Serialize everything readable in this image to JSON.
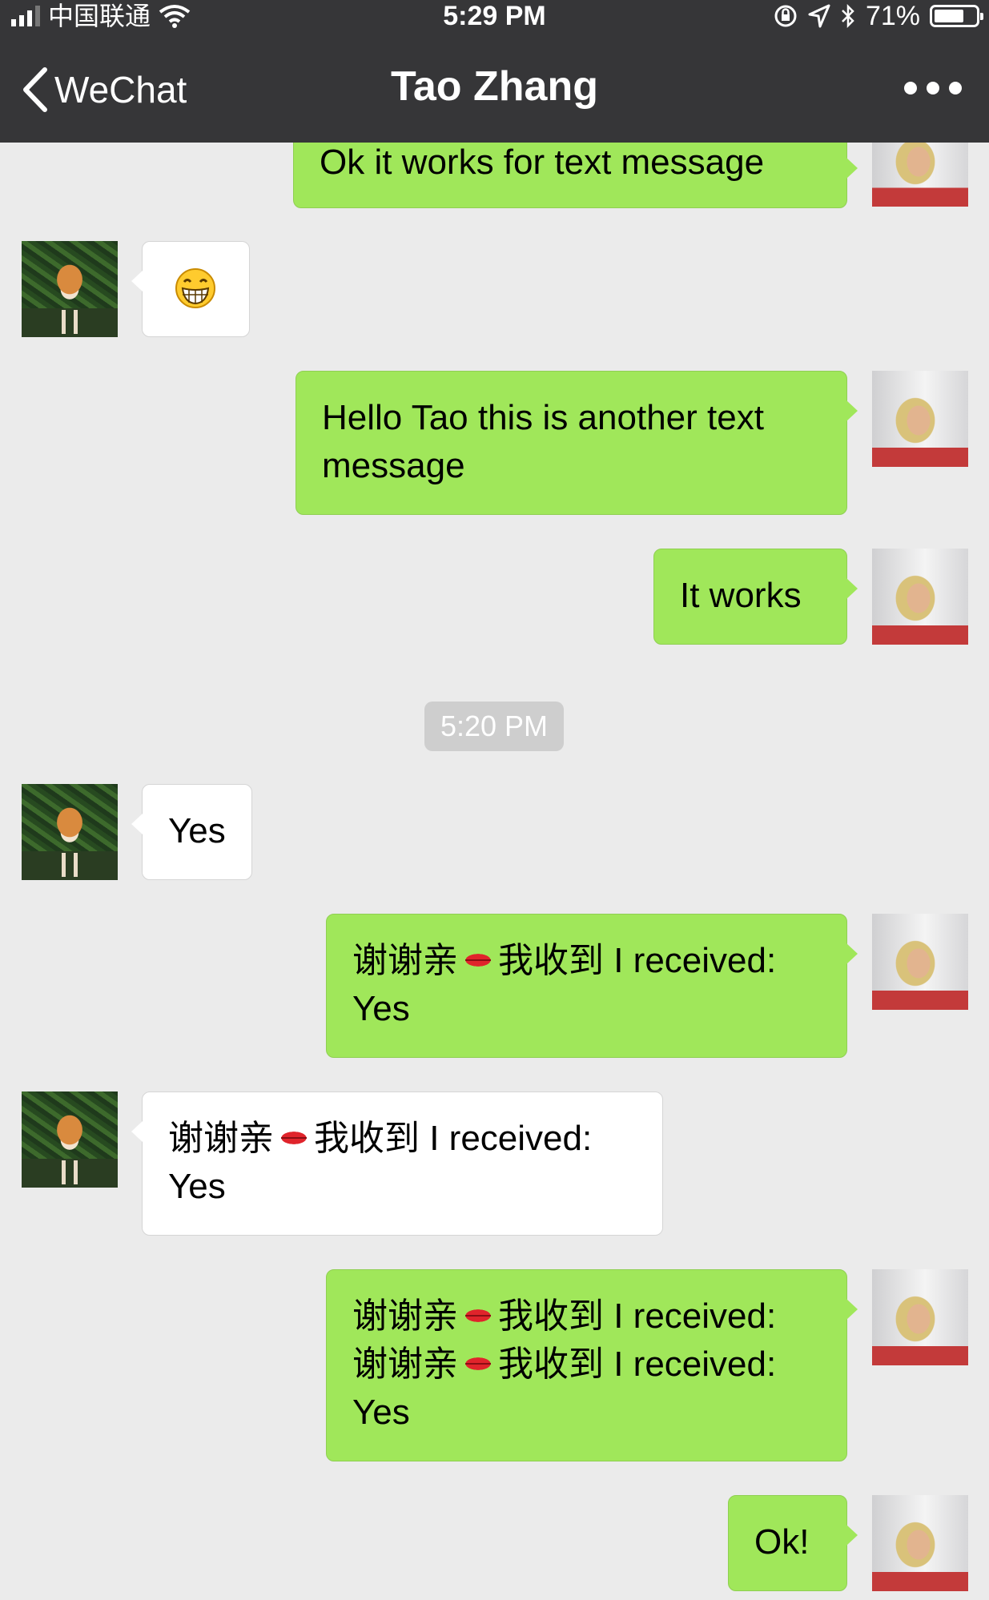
{
  "status_bar": {
    "carrier": "中国联通",
    "time": "5:29 PM",
    "battery": "71%",
    "battery_level": 0.71
  },
  "nav": {
    "back_label": "WeChat",
    "title": "Tao Zhang",
    "more_icon": "more-icon"
  },
  "messages": [
    {
      "from": "me",
      "text": "Ok it works for text message"
    },
    {
      "from": "them",
      "emoji": "grinning-face-icon"
    },
    {
      "from": "me",
      "text_line1": "Hello Tao this is another text",
      "text_line2": "message"
    },
    {
      "from": "me",
      "text": "It works"
    },
    {
      "from": "them",
      "text": "Yes"
    },
    {
      "from": "me",
      "a": "谢谢亲",
      "b": "我收到 I received:",
      "c": "Yes"
    },
    {
      "from": "them",
      "a": "谢谢亲",
      "b": "我收到 I received:",
      "c": "Yes"
    },
    {
      "from": "me",
      "a": "谢谢亲",
      "b": "我收到 I received:",
      "d": "谢谢亲",
      "e": "我收到 I received:",
      "c": "Yes"
    },
    {
      "from": "me",
      "text": "Ok!"
    }
  ],
  "timestamp": "5:20 PM",
  "colors": {
    "header": "#363638",
    "chat_bg": "#ebebeb",
    "my_bubble": "#a0e75a",
    "their_bubble": "#ffffff"
  }
}
